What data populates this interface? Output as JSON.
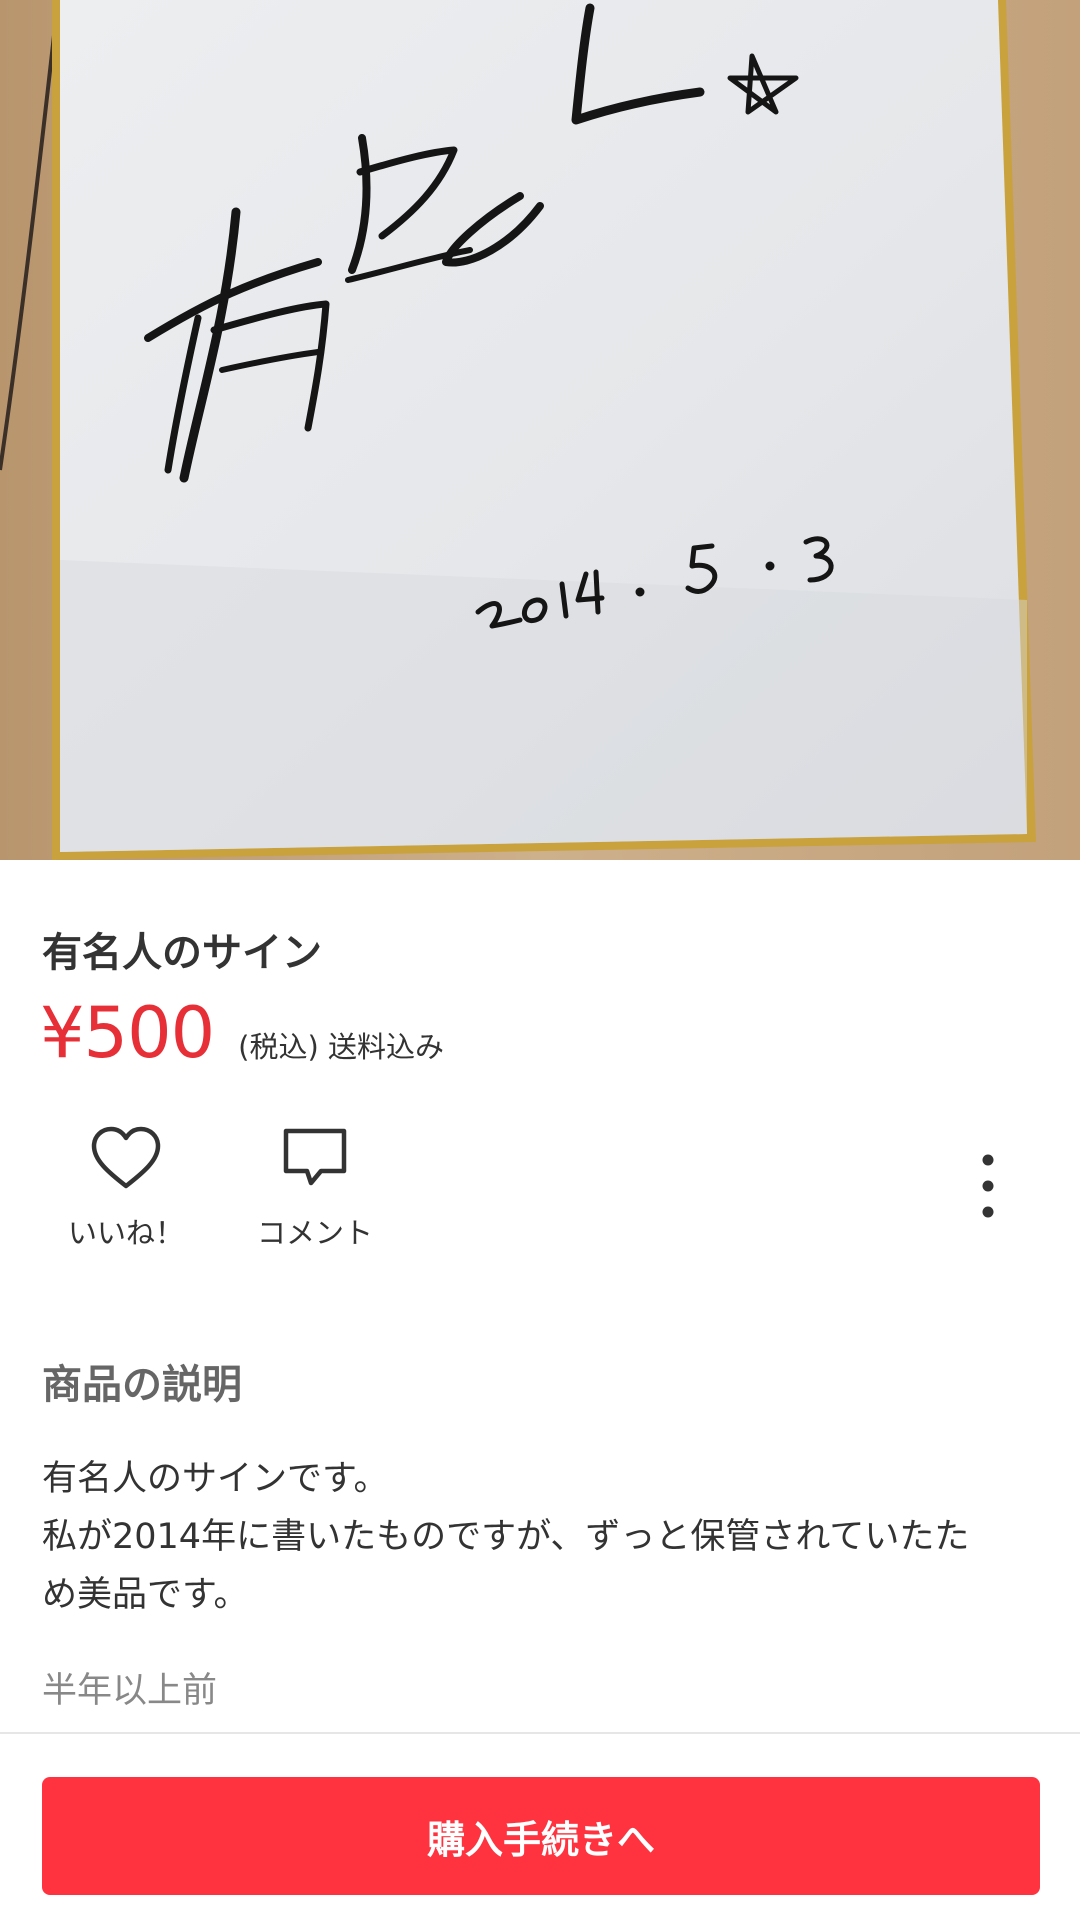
{
  "product": {
    "title": "有名人のサイン",
    "price": "¥500",
    "price_note": "(税込) 送料込み",
    "photo": {
      "signature_text": "有名人★",
      "signature_date": "2014・5・3"
    }
  },
  "actions": {
    "like_label": "いいね！",
    "comment_label": "コメント",
    "more_icon": "more-vertical-icon"
  },
  "description": {
    "heading": "商品の説明",
    "body": "有名人のサインです。\n私が2014年に書いたものですが、ずっと保管されていたた\nめ美品です。",
    "posted": "半年以上前"
  },
  "purchase": {
    "button_label": "購入手続きへ"
  },
  "colors": {
    "price": "#e62f36",
    "purchase_button": "#ff333f",
    "text": "#333333",
    "muted": "#888888"
  }
}
